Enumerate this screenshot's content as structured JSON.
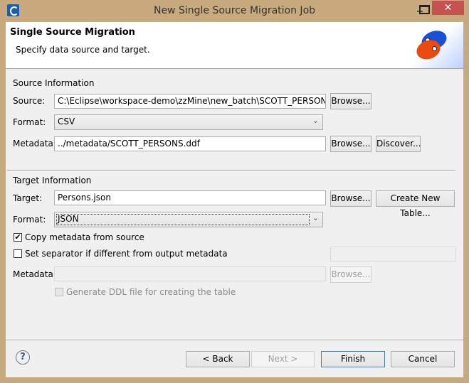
{
  "window": {
    "title": "New Single Source Migration Job",
    "close_glyph": "✕"
  },
  "banner": {
    "title": "Single Source Migration",
    "description": "Specify data source and target."
  },
  "source": {
    "section_title": "Source Information",
    "source_label": "Source:",
    "source_value": "C:\\Eclipse\\workspace-demo\\zzMine\\new_batch\\SCOTT_PERSONS.csv",
    "browse_label": "Browse...",
    "format_label": "Format:",
    "format_value": "CSV",
    "metadata_label": "Metadata:",
    "metadata_value": "../metadata/SCOTT_PERSONS.ddf",
    "metadata_browse_label": "Browse...",
    "discover_label": "Discover..."
  },
  "target": {
    "section_title": "Target Information",
    "target_label": "Target:",
    "target_value": "Persons.json",
    "browse_label": "Browse...",
    "create_table_label": "Create New Table...",
    "format_label": "Format:",
    "format_value": "JSON",
    "copy_metadata_label": "Copy metadata from source",
    "copy_metadata_checked": true,
    "separator_label": "Set separator if different from output metadata",
    "separator_checked": false,
    "separator_value": "",
    "metadata_label": "Metadata:",
    "metadata_value": "",
    "metadata_browse_label": "Browse...",
    "ddl_label": "Generate DDL file for creating the table",
    "ddl_checked": false
  },
  "footer": {
    "help_glyph": "?",
    "back_label": "< Back",
    "next_label": "Next >",
    "finish_label": "Finish",
    "cancel_label": "Cancel"
  }
}
